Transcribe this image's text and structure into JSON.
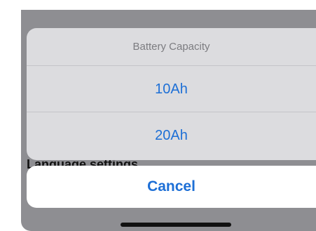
{
  "background": {
    "underlay_label": "Language settings"
  },
  "action_sheet": {
    "title": "Battery Capacity",
    "options": [
      {
        "label": "10Ah"
      },
      {
        "label": "20Ah"
      }
    ],
    "cancel_label": "Cancel"
  },
  "colors": {
    "accent": "#1d6fd6",
    "dim_overlay": "#8e8e92",
    "sheet_background": "#dcdcdf",
    "title_text": "#7c7c80",
    "separator": "#c4c4c8"
  }
}
